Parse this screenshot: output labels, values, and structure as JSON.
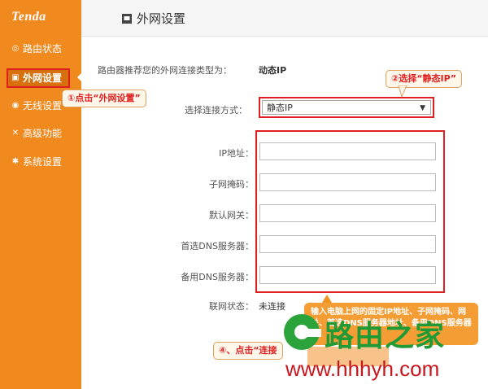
{
  "brand": {
    "logo_text": "Tenda"
  },
  "sidebar": {
    "items": [
      {
        "label": "路由状态",
        "icon": "status-icon"
      },
      {
        "label": "外网设置",
        "icon": "wan-icon",
        "active": true
      },
      {
        "label": "无线设置",
        "icon": "wifi-icon"
      },
      {
        "label": "高级功能",
        "icon": "tools-icon"
      },
      {
        "label": "系统设置",
        "icon": "gear-icon"
      }
    ]
  },
  "header": {
    "title": "外网设置",
    "icon": "wan-icon"
  },
  "recommend": {
    "label": "路由器推荐您的外网连接类型为：",
    "value": "动态IP"
  },
  "connection": {
    "label": "选择连接方式：",
    "selected": "静态IP"
  },
  "fields": [
    {
      "label": "IP地址：",
      "value": ""
    },
    {
      "label": "子网掩码：",
      "value": ""
    },
    {
      "label": "默认网关：",
      "value": ""
    },
    {
      "label": "首选DNS服务器：",
      "value": ""
    },
    {
      "label": "备用DNS服务器：",
      "value": ""
    }
  ],
  "status": {
    "label": "联网状态：",
    "value": "未连接"
  },
  "callouts": {
    "c1": "①点击“外网设置”",
    "c2": "②选择“静态IP”",
    "c4": "④、点击“连接",
    "tooltip": "输入电脑上网的固定IP地址、子网掩码、网关、首选DNS服务器地址、备用DNS服务器"
  },
  "watermark": {
    "cn": "路由之家",
    "url": "www.hhhyh.com"
  },
  "colors": {
    "sidebar": "#f08a1f",
    "highlight": "#e02020",
    "callout_text": "#e02020",
    "watermark_green": "#1f9a35",
    "watermark_red": "#c8161d"
  }
}
